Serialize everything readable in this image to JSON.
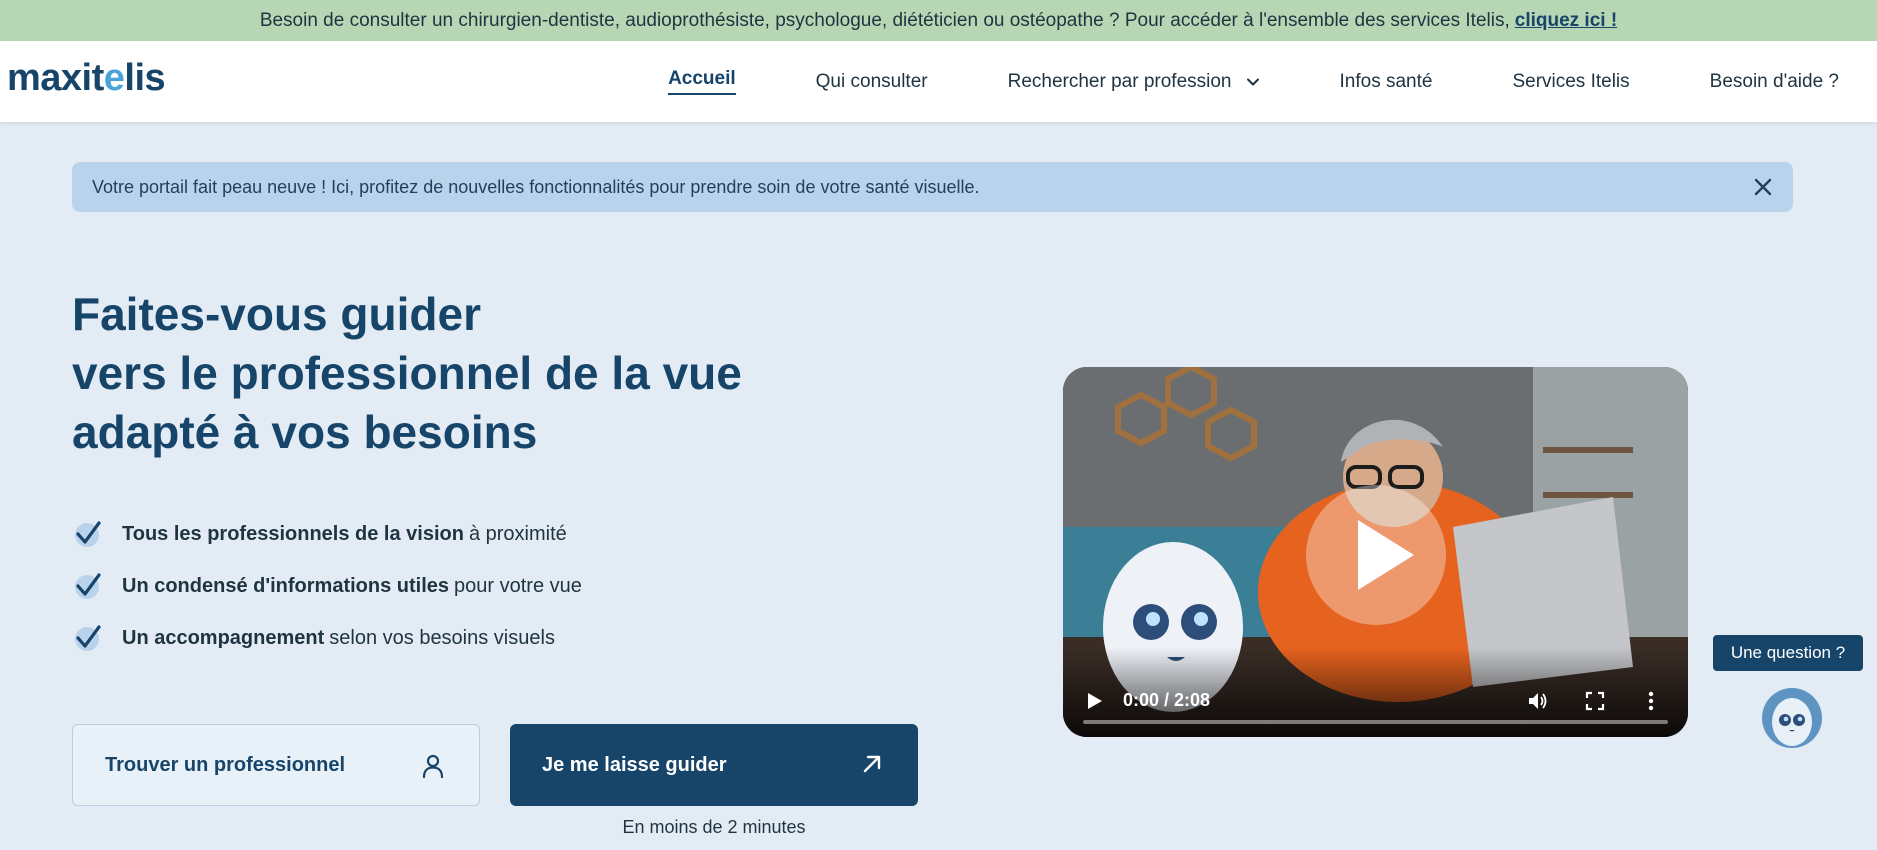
{
  "top_banner": {
    "text": "Besoin de consulter un chirurgien-dentiste, audioprothésiste, psychologue, diététicien ou ostéopathe ? Pour accéder à l'ensemble des services Itelis,",
    "link": "cliquez ici !"
  },
  "header": {
    "logo_part1": "maxit",
    "logo_part2": "e",
    "logo_part3": "lis",
    "nav": [
      {
        "label": "Accueil"
      },
      {
        "label": "Qui consulter"
      },
      {
        "label": "Rechercher par profession"
      },
      {
        "label": "Infos santé"
      },
      {
        "label": "Services Itelis"
      },
      {
        "label": "Besoin d'aide ?"
      }
    ]
  },
  "notice": {
    "text": "Votre portail fait peau neuve ! Ici, profitez de nouvelles fonctionnalités pour prendre soin de votre santé visuelle."
  },
  "hero": {
    "title_line1": "Faites-vous guider",
    "title_line2": "vers le professionnel de la vue",
    "title_line3": "adapté à vos besoins",
    "features": [
      {
        "bold": "Tous les professionnels de la vision",
        "rest": "à proximité"
      },
      {
        "bold": "Un condensé d'informations utiles",
        "rest": "pour votre vue"
      },
      {
        "bold": "Un accompagnement",
        "rest": "selon vos besoins visuels"
      }
    ],
    "btn_find": "Trouver un professionnel",
    "btn_guide": "Je me laisse guider",
    "guide_sub": "En moins de 2 minutes"
  },
  "video": {
    "time": "0:00 / 2:08",
    "progress": 0
  },
  "chat": {
    "label": "Une question ?"
  },
  "colors": {
    "primary": "#17456a",
    "banner_bg": "#b7d7b4",
    "page_bg": "#e3ecf5",
    "notice_bg": "#bad3ec"
  }
}
